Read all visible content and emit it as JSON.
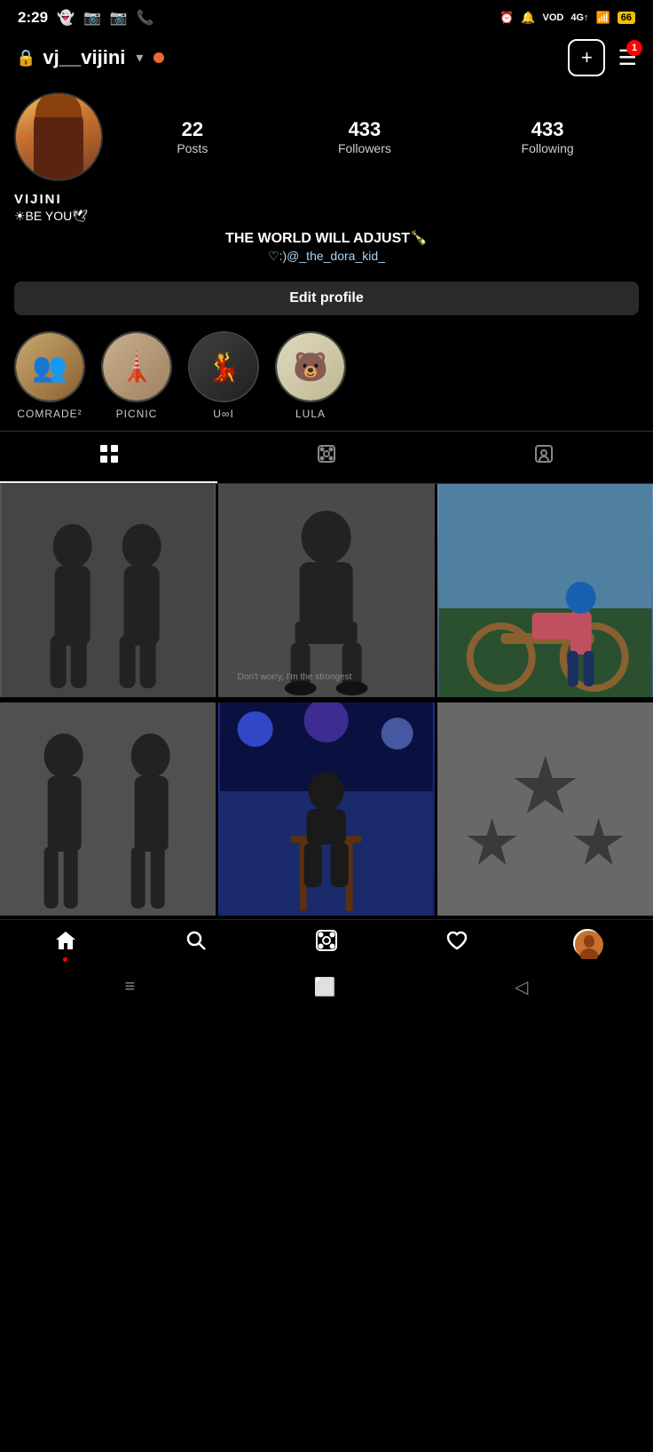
{
  "status": {
    "time": "2:29",
    "left_icons": [
      "👻",
      "📷",
      "📷",
      "📞"
    ],
    "right_icons": [
      "⏰",
      "🔔",
      "VOD",
      "4G",
      "battery"
    ]
  },
  "header": {
    "lock_icon": "🔒",
    "username": "vj__vijini",
    "add_label": "+",
    "menu_badge": "1"
  },
  "profile": {
    "name": "VIJINI",
    "bio_line1": "☀BE YOU🕊",
    "bio_quote": "THE WORLD WILL ADJUST🍾",
    "bio_link": "♡:)@_the_dora_kid_",
    "stats": {
      "posts": {
        "count": "22",
        "label": "Posts"
      },
      "followers": {
        "count": "433",
        "label": "Followers"
      },
      "following": {
        "count": "433",
        "label": "Following"
      }
    },
    "edit_button": "Edit profile"
  },
  "stories": [
    {
      "label": "COMRADE²",
      "emoji": "👥"
    },
    {
      "label": "PICNIC",
      "emoji": "🗼"
    },
    {
      "label": "U∞I",
      "emoji": "💃"
    },
    {
      "label": "LULA",
      "emoji": "🐻"
    }
  ],
  "tabs": [
    {
      "id": "grid",
      "icon": "⊞",
      "active": true
    },
    {
      "id": "reels",
      "icon": "▶",
      "active": false
    },
    {
      "id": "tagged",
      "icon": "🏷",
      "active": false
    }
  ],
  "bottom_nav": [
    {
      "id": "home",
      "icon": "🏠",
      "has_dot": true
    },
    {
      "id": "search",
      "icon": "🔍",
      "has_dot": false
    },
    {
      "id": "reels",
      "icon": "▶",
      "has_dot": false
    },
    {
      "id": "likes",
      "icon": "🤍",
      "has_dot": false
    },
    {
      "id": "profile",
      "icon": "avatar",
      "has_dot": false
    }
  ],
  "android_nav": {
    "menu": "≡",
    "home": "⬜",
    "back": "◁"
  }
}
